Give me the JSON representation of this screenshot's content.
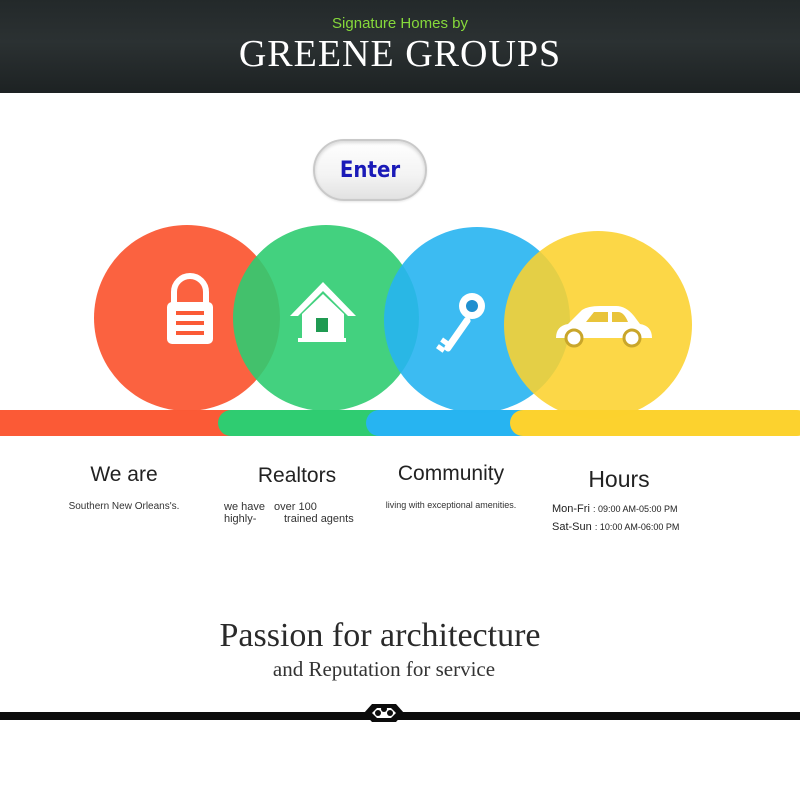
{
  "header": {
    "subtitle": "Signature Homes by",
    "brand": "GREENE GROUPS"
  },
  "enter_button": {
    "label": "Enter"
  },
  "features": [
    {
      "icon": "lock-icon",
      "color": "#fb5a36",
      "heading": "We are",
      "text": "Southern New Orleans's."
    },
    {
      "icon": "house-icon",
      "color": "#2fcc71",
      "heading": "Realtors",
      "text_a": "we have",
      "text_b": "over 100",
      "text_c": "highly-",
      "text_d": "trained agents"
    },
    {
      "icon": "key-icon",
      "color": "#27b4f1",
      "heading": "Community",
      "text": "living with exceptional amenities."
    },
    {
      "icon": "car-icon",
      "color": "#fcd22e",
      "heading": "Hours",
      "hours": [
        {
          "days": "Mon-Fri",
          "time": ": 09:00 AM-05:00 PM"
        },
        {
          "days": "Sat-Sun",
          "time": ": 10:00 AM-06:00 PM"
        }
      ]
    }
  ],
  "tagline": {
    "line1": "Passion for architecture",
    "line2": "and Reputation for service"
  }
}
